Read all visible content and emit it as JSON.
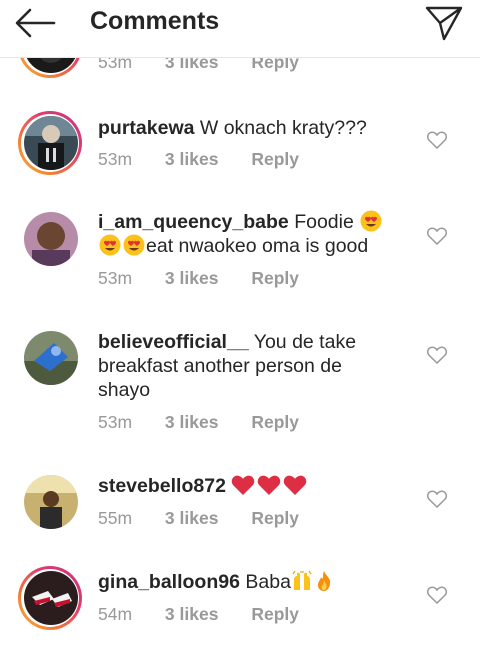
{
  "header": {
    "title": "Comments",
    "back_icon": "arrow-left-icon",
    "send_icon": "paper-plane-icon"
  },
  "colors": {
    "text": "#262626",
    "meta": "#999999",
    "divider": "#e6e6e6"
  },
  "comments": [
    {
      "username": "",
      "text": "",
      "time": "53m",
      "likes": "3 likes",
      "reply": "Reply"
    },
    {
      "username": "purtakewa",
      "text": "W oknach kraty???",
      "time": "53m",
      "likes": "3 likes",
      "reply": "Reply"
    },
    {
      "username": "i_am_queency_babe",
      "text_pre": "Foodie",
      "text_post": "eat nwaokeo oma is good",
      "time": "53m",
      "likes": "3 likes",
      "reply": "Reply"
    },
    {
      "username": "believeofficial__",
      "text": "You de take breakfast another person de shayo",
      "time": "53m",
      "likes": "3 likes",
      "reply": "Reply"
    },
    {
      "username": "stevebello872",
      "text": "",
      "time": "55m",
      "likes": "3 likes",
      "reply": "Reply"
    },
    {
      "username": "gina_balloon96",
      "text": "Baba",
      "time": "54m",
      "likes": "3 likes",
      "reply": "Reply"
    }
  ]
}
